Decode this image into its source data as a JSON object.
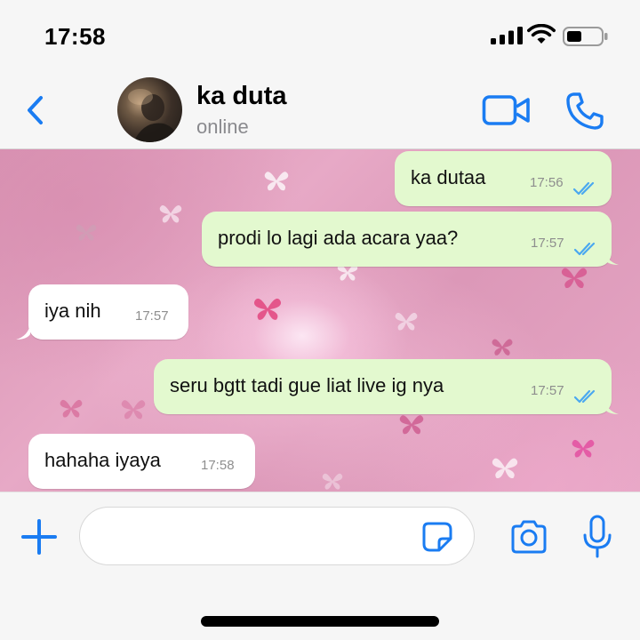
{
  "status_bar": {
    "time": "17:58"
  },
  "header": {
    "contact_name": "ka duta",
    "contact_status": "online",
    "icons": [
      "back-chevron-icon",
      "video-call-icon",
      "phone-icon"
    ]
  },
  "messages": [
    {
      "direction": "outgoing",
      "text": "ka dutaa",
      "time": "17:56",
      "read": true
    },
    {
      "direction": "outgoing",
      "text": "prodi lo lagi ada acara yaa?",
      "time": "17:57",
      "read": true
    },
    {
      "direction": "incoming",
      "text": "iya nih",
      "time": "17:57"
    },
    {
      "direction": "outgoing",
      "text": "seru bgtt tadi gue liat live ig nya",
      "time": "17:57",
      "read": true
    },
    {
      "direction": "incoming",
      "text": "hahaha iyaya",
      "time": "17:58"
    }
  ],
  "input_bar": {
    "message_value": "",
    "icons": [
      "plus-icon",
      "sticker-icon",
      "camera-icon",
      "microphone-icon"
    ]
  },
  "colors": {
    "accent": "#1a7cf2",
    "outgoing_bubble": "#e3f9cf",
    "incoming_bubble": "#ffffff",
    "read_ticks": "#4aa8f0",
    "wallpaper": "#e2a2c0"
  }
}
